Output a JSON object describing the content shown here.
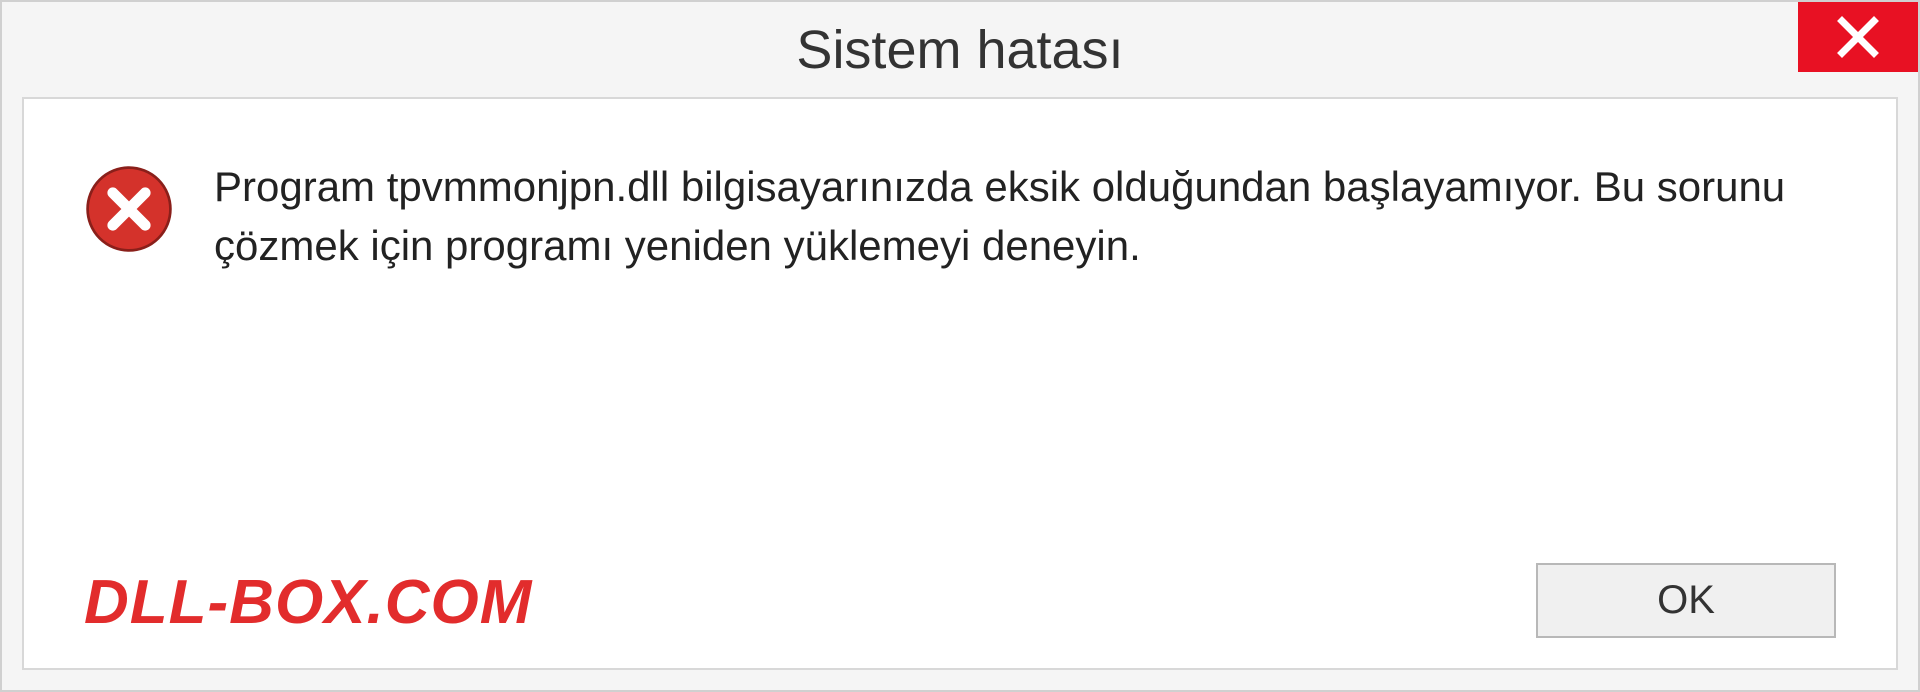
{
  "dialog": {
    "title": "Sistem hatası",
    "message": "Program tpvmmonjpn.dll bilgisayarınızda eksik olduğundan başlayamıyor. Bu sorunu çözmek için programı yeniden yüklemeyi deneyin.",
    "ok_label": "OK"
  },
  "watermark": "DLL-BOX.COM",
  "colors": {
    "close_bg": "#e81123",
    "error_icon": "#d4322b",
    "watermark_color": "#e22c2c"
  },
  "icons": {
    "close": "close-icon",
    "error": "error-circle-icon"
  }
}
